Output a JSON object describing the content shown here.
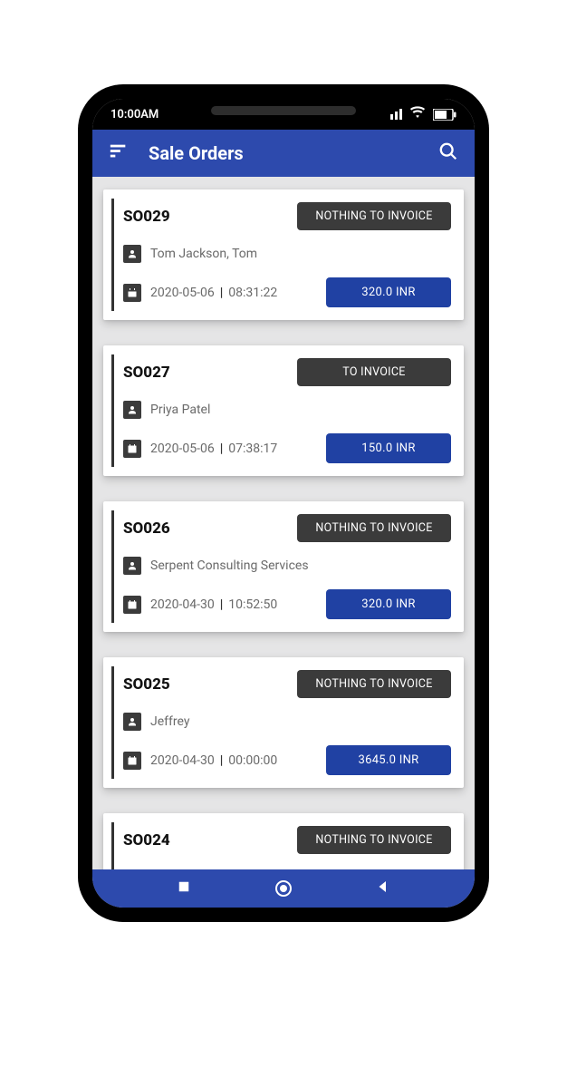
{
  "statusBar": {
    "time": "10:00AM"
  },
  "header": {
    "title": "Sale Orders"
  },
  "orders": [
    {
      "id": "SO029",
      "status": "NOTHING TO INVOICE",
      "customer": "Tom Jackson, Tom",
      "date": "2020-05-06",
      "time": "08:31:22",
      "amount": "320.0 INR"
    },
    {
      "id": "SO027",
      "status": "TO INVOICE",
      "customer": "Priya Patel",
      "date": "2020-05-06",
      "time": "07:38:17",
      "amount": "150.0 INR"
    },
    {
      "id": "SO026",
      "status": "NOTHING TO INVOICE",
      "customer": "Serpent Consulting Services",
      "date": "2020-04-30",
      "time": "10:52:50",
      "amount": "320.0 INR"
    },
    {
      "id": "SO025",
      "status": "NOTHING TO INVOICE",
      "customer": "Jeffrey",
      "date": "2020-04-30",
      "time": "00:00:00",
      "amount": "3645.0 INR"
    },
    {
      "id": "SO024",
      "status": "NOTHING TO INVOICE",
      "customer": "",
      "date": "",
      "time": "",
      "amount": ""
    }
  ]
}
